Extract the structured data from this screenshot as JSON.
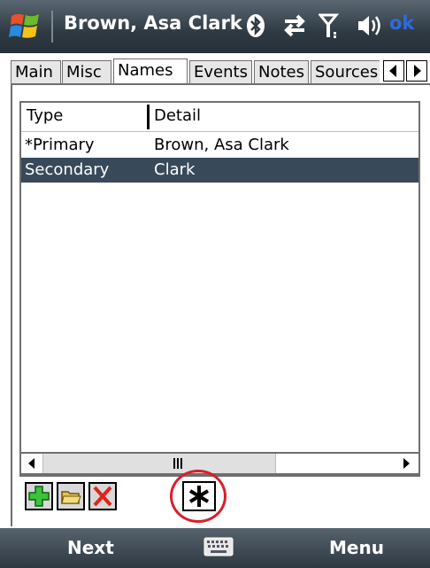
{
  "titlebar": {
    "title": "Brown, Asa Clark",
    "ok_label": "ok",
    "icons": [
      "windows-start-icon",
      "bluetooth-icon",
      "data-connection-icon",
      "signal-strength-icon",
      "volume-icon"
    ]
  },
  "tabs": {
    "items": [
      {
        "label": "Main"
      },
      {
        "label": "Misc"
      },
      {
        "label": "Names",
        "active": true
      },
      {
        "label": "Events"
      },
      {
        "label": "Notes"
      },
      {
        "label": "Sources"
      }
    ],
    "scroll_icons": [
      "tab-scroll-left-icon",
      "tab-scroll-right-icon"
    ]
  },
  "list": {
    "columns": [
      "Type",
      "Detail"
    ],
    "rows": [
      {
        "type": "*Primary",
        "detail": "Brown, Asa Clark",
        "selected": false
      },
      {
        "type": "Secondary",
        "detail": "Clark",
        "selected": true
      }
    ]
  },
  "toolbar": {
    "icons": [
      "add-icon",
      "edit-folder-icon",
      "delete-icon",
      "asterisk-icon"
    ]
  },
  "softkeys": {
    "left": "Next",
    "right": "Menu"
  },
  "colors": {
    "selection": "#38495a",
    "highlight_circle": "#d91f2a",
    "ok": "#2d6cd8"
  }
}
